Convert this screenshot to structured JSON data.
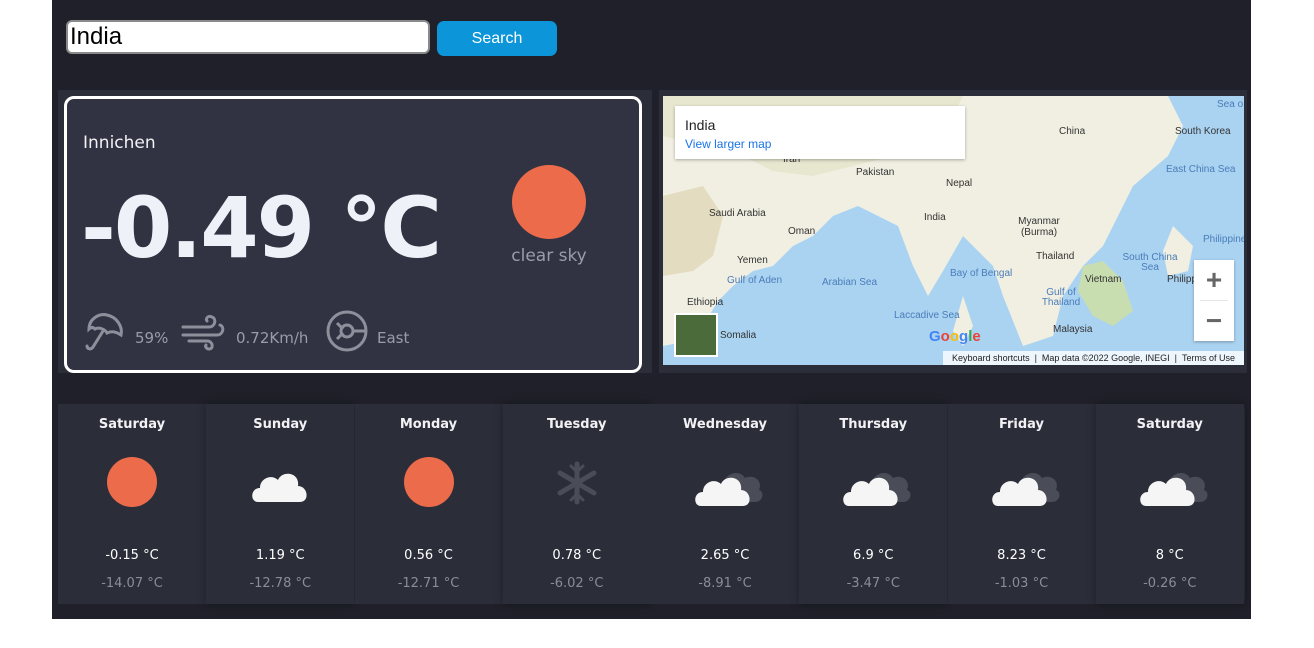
{
  "search": {
    "value": "India",
    "button_label": "Search"
  },
  "current": {
    "city": "Innichen",
    "temperature": "-0.49 °C",
    "description": "clear sky",
    "humidity": "59%",
    "wind_speed": "0.72Km/h",
    "wind_direction": "East",
    "icon": "sun-icon"
  },
  "map": {
    "place_title": "India",
    "larger_map_link": "View larger map",
    "footer": {
      "shortcuts": "Keyboard shortcuts",
      "data": "Map data ©2022 Google, INEGI",
      "terms": "Terms of Use"
    },
    "labels": [
      "China",
      "South Korea",
      "Pakistan",
      "Nepal",
      "India",
      "Saudi Arabia",
      "Oman",
      "Myanmar (Burma)",
      "Yemen",
      "Thailand",
      "Vietnam",
      "Ethiopia",
      "Somalia",
      "Malaysia",
      "Iran",
      "Philippines",
      "Philippi"
    ],
    "sea_labels": [
      "East China Sea",
      "South China Sea",
      "Gulf of Aden",
      "Arabian Sea",
      "Bay of Bengal",
      "Laccadive Sea",
      "Gulf of Thailand",
      "Sea o"
    ],
    "zoom_in": "+",
    "zoom_out": "−",
    "logo": "Google"
  },
  "forecast": [
    {
      "day": "Saturday",
      "max": "-0.15 °C",
      "min": "-14.07 °C",
      "icon": "sun-icon"
    },
    {
      "day": "Sunday",
      "max": "1.19 °C",
      "min": "-12.78 °C",
      "icon": "cloud-icon"
    },
    {
      "day": "Monday",
      "max": "0.56 °C",
      "min": "-12.71 °C",
      "icon": "sun-icon"
    },
    {
      "day": "Tuesday",
      "max": "0.78 °C",
      "min": "-6.02 °C",
      "icon": "snowflake-icon"
    },
    {
      "day": "Wednesday",
      "max": "2.65 °C",
      "min": "-8.91 °C",
      "icon": "clouds-icon"
    },
    {
      "day": "Thursday",
      "max": "6.9 °C",
      "min": "-3.47 °C",
      "icon": "clouds-icon"
    },
    {
      "day": "Friday",
      "max": "8.23 °C",
      "min": "-1.03 °C",
      "icon": "clouds-icon"
    },
    {
      "day": "Saturday",
      "max": "8 °C",
      "min": "-0.26 °C",
      "icon": "clouds-icon"
    }
  ],
  "colors": {
    "sun": "#ec6b4a",
    "button": "#0d95d9",
    "background": "#1f2029",
    "card": "#313343"
  }
}
